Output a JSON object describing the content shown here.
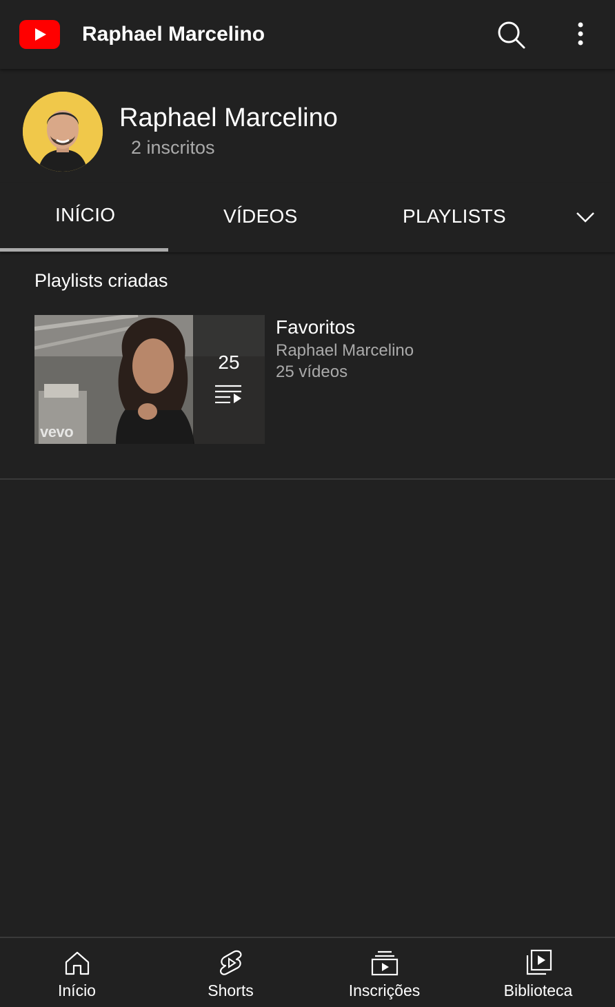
{
  "topbar": {
    "title": "Raphael Marcelino",
    "logo_icon": "youtube-logo-icon",
    "search_icon": "search-icon",
    "more_icon": "more-vert-icon",
    "brand_color": "#ff0000"
  },
  "channel": {
    "name": "Raphael Marcelino",
    "subscribers": "2 inscritos",
    "avatar_bg": "#f0c84a"
  },
  "tabs": [
    {
      "label": "INÍCIO",
      "selected": true
    },
    {
      "label": "VÍDEOS",
      "selected": false
    },
    {
      "label": "PLAYLISTS",
      "selected": false
    }
  ],
  "tabs_more_icon": "chevron-down-icon",
  "section": {
    "title": "Playlists criadas"
  },
  "playlist": {
    "title": "Favoritos",
    "owner": "Raphael Marcelino",
    "video_count": "25 vídeos",
    "thumb_count": "25",
    "thumb_watermark": "vevo",
    "thumb_icon": "playlist-play-icon"
  },
  "bottom_nav": [
    {
      "label": "Início",
      "icon": "home-icon"
    },
    {
      "label": "Shorts",
      "icon": "shorts-icon"
    },
    {
      "label": "Inscrições",
      "icon": "subscriptions-icon"
    },
    {
      "label": "Biblioteca",
      "icon": "library-icon"
    }
  ],
  "colors": {
    "background": "#212121",
    "secondary_text": "#aaaaaa",
    "tab_indicator": "#aaaaaa"
  }
}
